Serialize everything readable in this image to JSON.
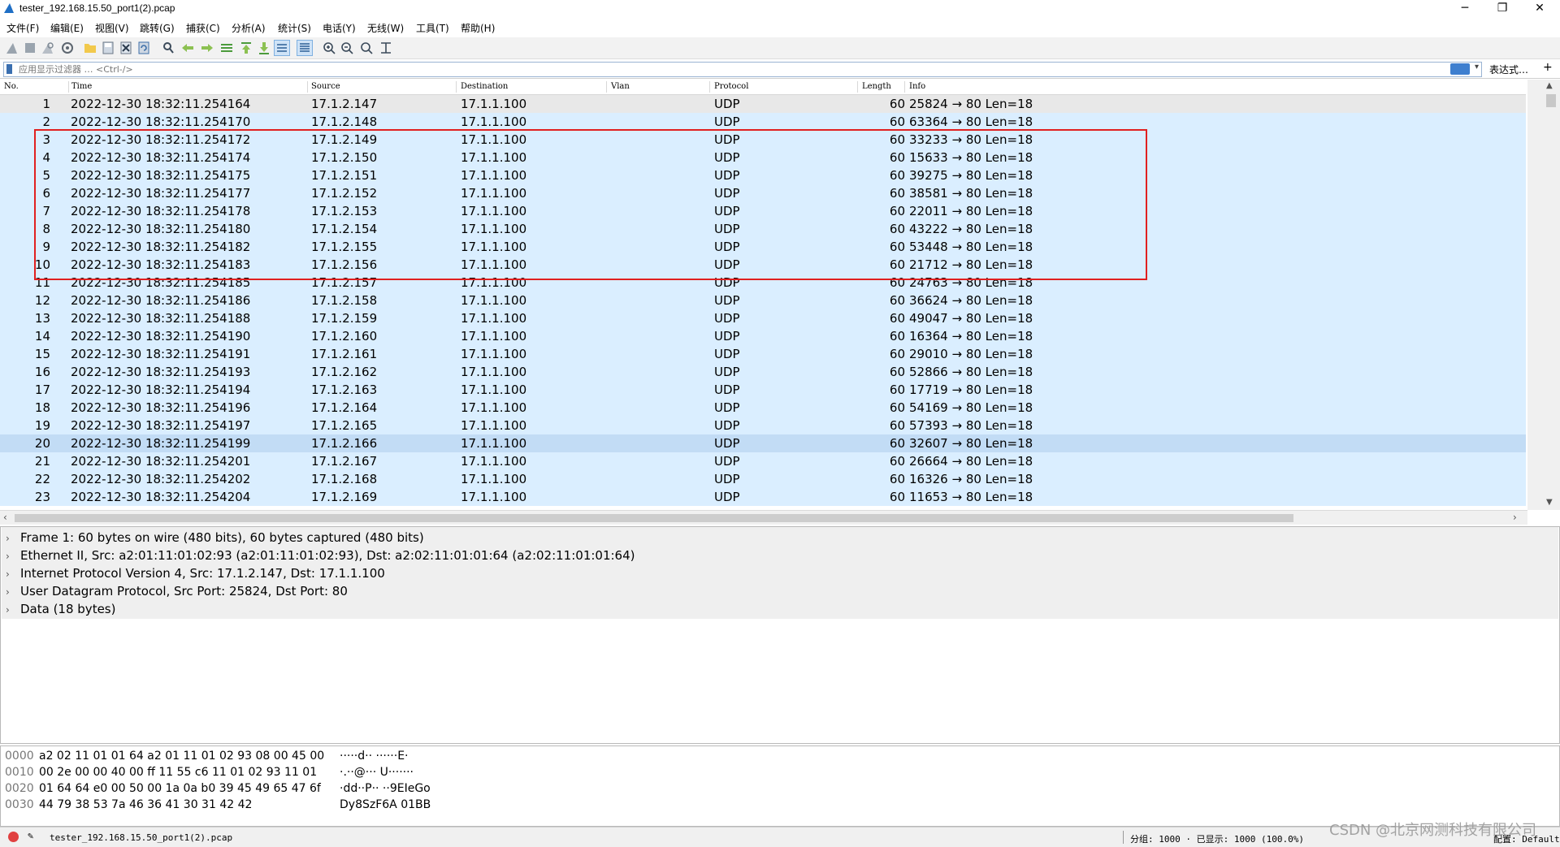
{
  "window": {
    "title": "tester_192.168.15.50_port1(2).pcap",
    "minimize": "─",
    "restore": "❐",
    "close": "✕"
  },
  "menu": [
    "文件(F)",
    "编辑(E)",
    "视图(V)",
    "跳转(G)",
    "捕获(C)",
    "分析(A)",
    "统计(S)",
    "电话(Y)",
    "无线(W)",
    "工具(T)",
    "帮助(H)"
  ],
  "toolbar_icons": [
    "shark-fin-start-icon",
    "stop-square-icon",
    "restart-fin-icon",
    "capture-options-gear-icon",
    "open-folder-icon",
    "save-file-icon",
    "close-file-icon",
    "reload-icon",
    "find-magnifier-icon",
    "back-arrow-icon",
    "forward-arrow-icon",
    "goto-packet-icon",
    "first-packet-icon",
    "last-packet-icon",
    "autoscroll-icon",
    "colorize-lines-icon",
    "zoom-in-icon",
    "zoom-out-icon",
    "normal-size-icon",
    "resize-columns-icon"
  ],
  "filter": {
    "placeholder": "应用显示过滤器 … <Ctrl-/>",
    "expression_label": "表达式…",
    "plus": "+"
  },
  "columns": {
    "no": "No.",
    "time": "Time",
    "source": "Source",
    "destination": "Destination",
    "vlan": "Vlan",
    "protocol": "Protocol",
    "length": "Length",
    "info": "Info"
  },
  "packets": [
    {
      "no": "1",
      "time": "2022-12-30 18:32:11.254164",
      "src": "17.1.2.147",
      "dst": "17.1.1.100",
      "proto": "UDP",
      "len": "60",
      "info": "25824 → 80 Len=18"
    },
    {
      "no": "2",
      "time": "2022-12-30 18:32:11.254170",
      "src": "17.1.2.148",
      "dst": "17.1.1.100",
      "proto": "UDP",
      "len": "60",
      "info": "63364 → 80 Len=18"
    },
    {
      "no": "3",
      "time": "2022-12-30 18:32:11.254172",
      "src": "17.1.2.149",
      "dst": "17.1.1.100",
      "proto": "UDP",
      "len": "60",
      "info": "33233 → 80 Len=18"
    },
    {
      "no": "4",
      "time": "2022-12-30 18:32:11.254174",
      "src": "17.1.2.150",
      "dst": "17.1.1.100",
      "proto": "UDP",
      "len": "60",
      "info": "15633 → 80 Len=18"
    },
    {
      "no": "5",
      "time": "2022-12-30 18:32:11.254175",
      "src": "17.1.2.151",
      "dst": "17.1.1.100",
      "proto": "UDP",
      "len": "60",
      "info": "39275 → 80 Len=18"
    },
    {
      "no": "6",
      "time": "2022-12-30 18:32:11.254177",
      "src": "17.1.2.152",
      "dst": "17.1.1.100",
      "proto": "UDP",
      "len": "60",
      "info": "38581 → 80 Len=18"
    },
    {
      "no": "7",
      "time": "2022-12-30 18:32:11.254178",
      "src": "17.1.2.153",
      "dst": "17.1.1.100",
      "proto": "UDP",
      "len": "60",
      "info": "22011 → 80 Len=18"
    },
    {
      "no": "8",
      "time": "2022-12-30 18:32:11.254180",
      "src": "17.1.2.154",
      "dst": "17.1.1.100",
      "proto": "UDP",
      "len": "60",
      "info": "43222 → 80 Len=18"
    },
    {
      "no": "9",
      "time": "2022-12-30 18:32:11.254182",
      "src": "17.1.2.155",
      "dst": "17.1.1.100",
      "proto": "UDP",
      "len": "60",
      "info": "53448 → 80 Len=18"
    },
    {
      "no": "10",
      "time": "2022-12-30 18:32:11.254183",
      "src": "17.1.2.156",
      "dst": "17.1.1.100",
      "proto": "UDP",
      "len": "60",
      "info": "21712 → 80 Len=18"
    },
    {
      "no": "11",
      "time": "2022-12-30 18:32:11.254185",
      "src": "17.1.2.157",
      "dst": "17.1.1.100",
      "proto": "UDP",
      "len": "60",
      "info": "24763 → 80 Len=18"
    },
    {
      "no": "12",
      "time": "2022-12-30 18:32:11.254186",
      "src": "17.1.2.158",
      "dst": "17.1.1.100",
      "proto": "UDP",
      "len": "60",
      "info": "36624 → 80 Len=18"
    },
    {
      "no": "13",
      "time": "2022-12-30 18:32:11.254188",
      "src": "17.1.2.159",
      "dst": "17.1.1.100",
      "proto": "UDP",
      "len": "60",
      "info": "49047 → 80 Len=18"
    },
    {
      "no": "14",
      "time": "2022-12-30 18:32:11.254190",
      "src": "17.1.2.160",
      "dst": "17.1.1.100",
      "proto": "UDP",
      "len": "60",
      "info": "16364 → 80 Len=18"
    },
    {
      "no": "15",
      "time": "2022-12-30 18:32:11.254191",
      "src": "17.1.2.161",
      "dst": "17.1.1.100",
      "proto": "UDP",
      "len": "60",
      "info": "29010 → 80 Len=18"
    },
    {
      "no": "16",
      "time": "2022-12-30 18:32:11.254193",
      "src": "17.1.2.162",
      "dst": "17.1.1.100",
      "proto": "UDP",
      "len": "60",
      "info": "52866 → 80 Len=18"
    },
    {
      "no": "17",
      "time": "2022-12-30 18:32:11.254194",
      "src": "17.1.2.163",
      "dst": "17.1.1.100",
      "proto": "UDP",
      "len": "60",
      "info": "17719 → 80 Len=18"
    },
    {
      "no": "18",
      "time": "2022-12-30 18:32:11.254196",
      "src": "17.1.2.164",
      "dst": "17.1.1.100",
      "proto": "UDP",
      "len": "60",
      "info": "54169 → 80 Len=18"
    },
    {
      "no": "19",
      "time": "2022-12-30 18:32:11.254197",
      "src": "17.1.2.165",
      "dst": "17.1.1.100",
      "proto": "UDP",
      "len": "60",
      "info": "57393 → 80 Len=18"
    },
    {
      "no": "20",
      "time": "2022-12-30 18:32:11.254199",
      "src": "17.1.2.166",
      "dst": "17.1.1.100",
      "proto": "UDP",
      "len": "60",
      "info": "32607 → 80 Len=18"
    },
    {
      "no": "21",
      "time": "2022-12-30 18:32:11.254201",
      "src": "17.1.2.167",
      "dst": "17.1.1.100",
      "proto": "UDP",
      "len": "60",
      "info": "26664 → 80 Len=18"
    },
    {
      "no": "22",
      "time": "2022-12-30 18:32:11.254202",
      "src": "17.1.2.168",
      "dst": "17.1.1.100",
      "proto": "UDP",
      "len": "60",
      "info": "16326 → 80 Len=18"
    },
    {
      "no": "23",
      "time": "2022-12-30 18:32:11.254204",
      "src": "17.1.2.169",
      "dst": "17.1.1.100",
      "proto": "UDP",
      "len": "60",
      "info": "11653 → 80 Len=18"
    }
  ],
  "details": [
    "Frame 1: 60 bytes on wire (480 bits), 60 bytes captured (480 bits)",
    "Ethernet II, Src: a2:01:11:01:02:93 (a2:01:11:01:02:93), Dst: a2:02:11:01:01:64 (a2:02:11:01:01:64)",
    "Internet Protocol Version 4, Src: 17.1.2.147, Dst: 17.1.1.100",
    "User Datagram Protocol, Src Port: 25824, Dst Port: 80",
    "Data (18 bytes)"
  ],
  "bytes": [
    {
      "offset": "0000",
      "hex": "a2 02 11 01 01 64 a2 01  11 01 02 93 08 00 45 00",
      "ascii": "·····d·· ······E·"
    },
    {
      "offset": "0010",
      "hex": "00 2e 00 00 40 00 ff 11  55 c6 11 01 02 93 11 01",
      "ascii": "·.··@··· U·······"
    },
    {
      "offset": "0020",
      "hex": "01 64 64 e0 00 50 00 1a  0a b0 39 45 49 65 47 6f",
      "ascii": "·dd··P·· ··9EIeGo"
    },
    {
      "offset": "0030",
      "hex": "44 79 38 53 7a 46 36 41  30 31 42 42",
      "ascii": "Dy8SzF6A 01BB"
    }
  ],
  "status": {
    "file": "tester_192.168.15.50_port1(2).pcap",
    "stats": "分组: 1000 · 已显示: 1000 (100.0%)",
    "profile": "配置: Default"
  },
  "watermark": "CSDN @北京网测科技有限公司",
  "colors": {
    "row_bg": "#daeeff",
    "selected_row_bg": "#c2dcf5",
    "first_row_bg": "#e8e8e8",
    "highlight_box": "#e02020"
  }
}
